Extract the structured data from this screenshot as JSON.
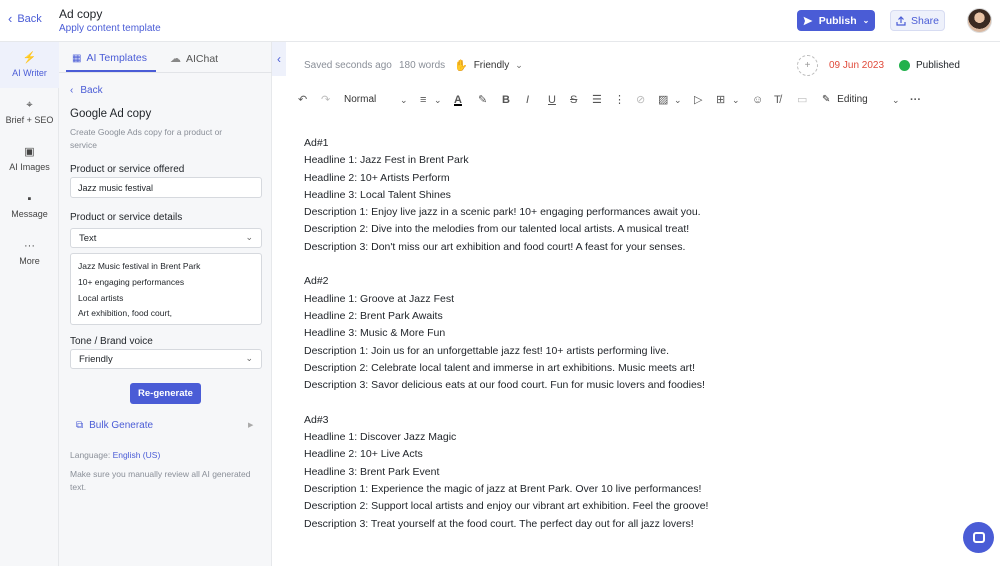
{
  "header": {
    "back_label": "Back",
    "title": "Ad copy",
    "subtitle": "Apply content template",
    "publish_label": "Publish",
    "share_label": "Share"
  },
  "rail": {
    "items": [
      {
        "label": "AI Writer",
        "icon": "lightning-icon",
        "active": true
      },
      {
        "label": "Brief + SEO",
        "icon": "target-icon"
      },
      {
        "label": "AI Images",
        "icon": "image-icon"
      },
      {
        "label": "Message",
        "icon": "chat-icon"
      },
      {
        "label": "More",
        "icon": "dots-icon"
      }
    ]
  },
  "panel": {
    "tabs": [
      {
        "label": "AI Templates",
        "icon": "grid-icon"
      },
      {
        "label": "AIChat",
        "icon": "cloud-icon"
      }
    ],
    "back_label": "Back",
    "template_title": "Google Ad copy",
    "template_desc": "Create Google Ads copy for a product or service",
    "product_label": "Product or service offered",
    "product_value": "Jazz music festival",
    "details_label": "Product or service details",
    "details_type": "Text",
    "details_lines": [
      "Jazz Music festival in Brent Park",
      "10+ engaging performances",
      "Local artists",
      "Art exhibition, food court,"
    ],
    "tone_label": "Tone / Brand voice",
    "tone_value": "Friendly",
    "regenerate_label": "Re-generate",
    "bulk_label": "Bulk Generate",
    "language_label": "Language:",
    "language_value": "English (US)",
    "note": "Make sure you manually review all AI generated text."
  },
  "status": {
    "saved": "Saved seconds ago",
    "words": "180 words",
    "tone": "Friendly",
    "date": "09 Jun 2023",
    "published": "Published"
  },
  "toolbar": {
    "style": "Normal",
    "mode": "Editing"
  },
  "editor": {
    "lines": [
      "Ad#1",
      "Headline 1: Jazz Fest in Brent Park",
      "Headline 2: 10+ Artists Perform",
      "Headline 3: Local Talent Shines",
      "Description 1: Enjoy live jazz in a scenic park! 10+ engaging performances await you.",
      "Description 2: Dive into the melodies from our talented local artists. A musical treat!",
      "Description 3: Don't miss our art exhibition and food court! A feast for your senses.",
      "",
      "Ad#2",
      "Headline 1: Groove at Jazz Fest",
      "Headline 2: Brent Park Awaits",
      "Headline 3: Music & More Fun",
      "Description 1: Join us for an unforgettable jazz fest! 10+ artists performing live.",
      "Description 2: Celebrate local talent and immerse in art exhibitions. Music meets art!",
      "Description 3: Savor delicious eats at our food court. Fun for music lovers and foodies!",
      "",
      "Ad#3",
      "Headline 1: Discover Jazz Magic",
      "Headline 2: 10+ Live Acts",
      "Headline 3: Brent Park Event",
      "Description 1: Experience the magic of jazz at Brent Park. Over 10 live performances!",
      "Description 2: Support local artists and enjoy our vibrant art exhibition. Feel the groove!",
      "Description 3: Treat yourself at the food court. The perfect day out for all jazz lovers!"
    ]
  },
  "colors": {
    "accent": "#4a5cd6",
    "date": "#e04a3a",
    "published": "#22b14c"
  }
}
